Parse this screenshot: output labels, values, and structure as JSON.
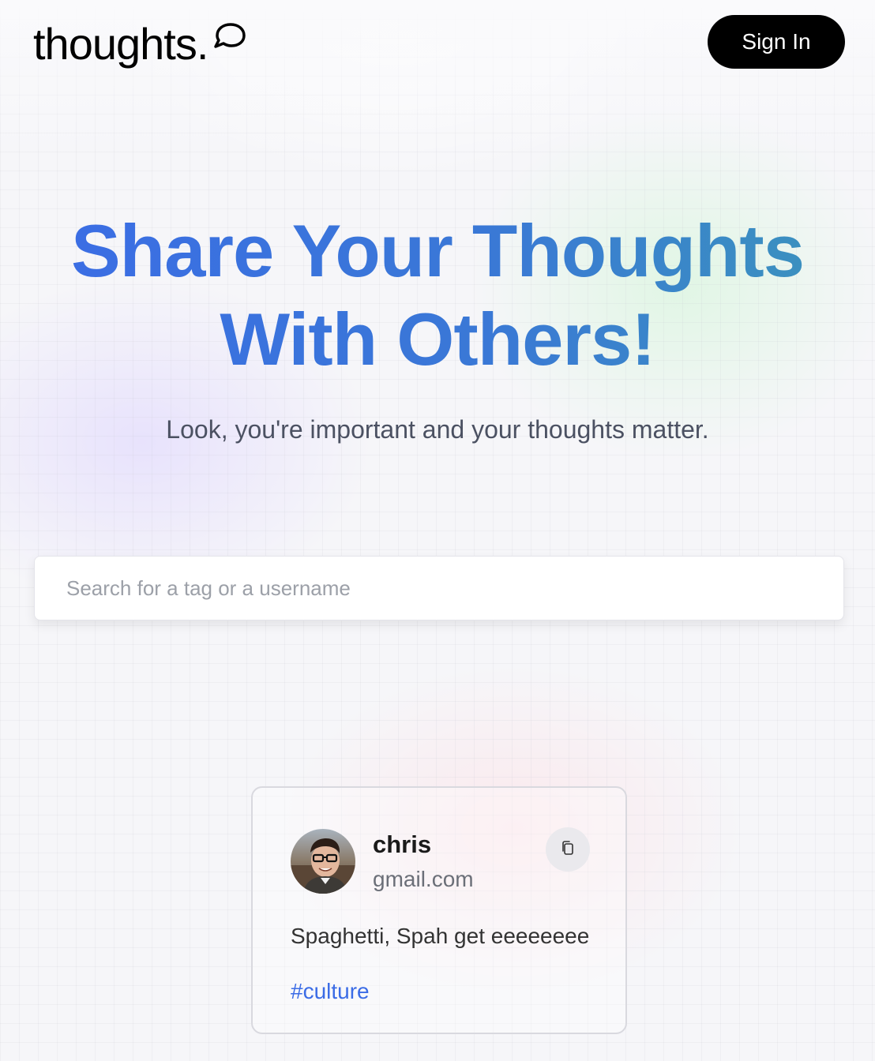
{
  "header": {
    "logo_text": "thoughts.",
    "logo_icon": "speech-bubble-icon",
    "signin_label": "Sign In"
  },
  "hero": {
    "headline_line1": "Share Your Thoughts",
    "headline_line2": "With Others!",
    "subheadline": "Look, you're important and your thoughts matter.",
    "gradient_colors": [
      "#3b6ce6",
      "#3b95bb"
    ]
  },
  "search": {
    "placeholder": "Search for a tag or a username",
    "value": ""
  },
  "feed": {
    "posts": [
      {
        "username": "chris",
        "email": "gmail.com",
        "text": "Spaghetti, Spah get eeeeeeee",
        "tag": "#culture",
        "copy_icon": "copy-icon",
        "avatar": "user-avatar"
      }
    ]
  },
  "colors": {
    "accent": "#3b6ce6",
    "button_bg": "#000000",
    "button_text": "#ffffff"
  }
}
